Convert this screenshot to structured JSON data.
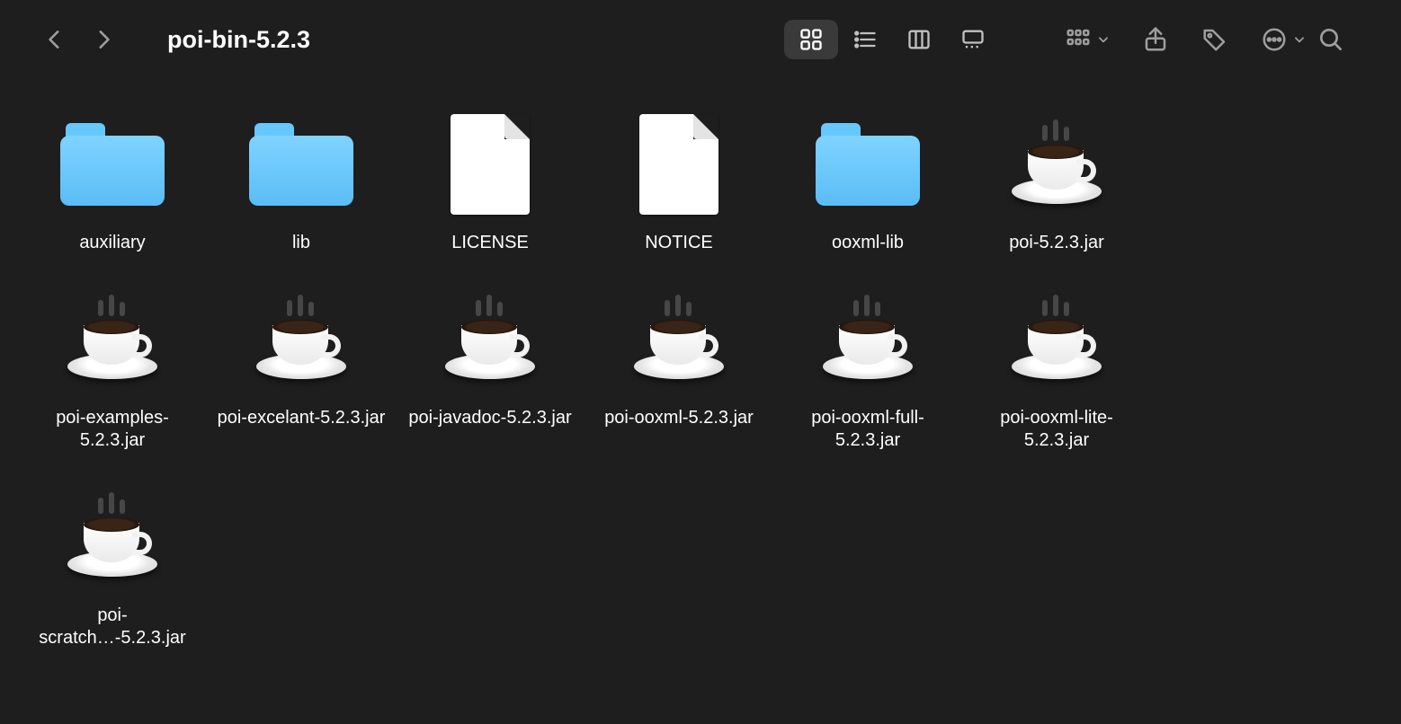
{
  "window": {
    "title": "poi-bin-5.2.3"
  },
  "items": [
    {
      "name": "auxiliary",
      "kind": "folder"
    },
    {
      "name": "lib",
      "kind": "folder"
    },
    {
      "name": "LICENSE",
      "kind": "document"
    },
    {
      "name": "NOTICE",
      "kind": "document"
    },
    {
      "name": "ooxml-lib",
      "kind": "folder"
    },
    {
      "name": "poi-5.2.3.jar",
      "kind": "jar"
    },
    {
      "name": "poi-examples-5.2.3.jar",
      "kind": "jar"
    },
    {
      "name": "poi-excelant-5.2.3.jar",
      "kind": "jar"
    },
    {
      "name": "poi-javadoc-5.2.3.jar",
      "kind": "jar"
    },
    {
      "name": "poi-ooxml-5.2.3.jar",
      "kind": "jar"
    },
    {
      "name": "poi-ooxml-full-5.2.3.jar",
      "kind": "jar"
    },
    {
      "name": "poi-ooxml-lite-5.2.3.jar",
      "kind": "jar"
    },
    {
      "name": "poi-scratch…-5.2.3.jar",
      "kind": "jar"
    }
  ]
}
